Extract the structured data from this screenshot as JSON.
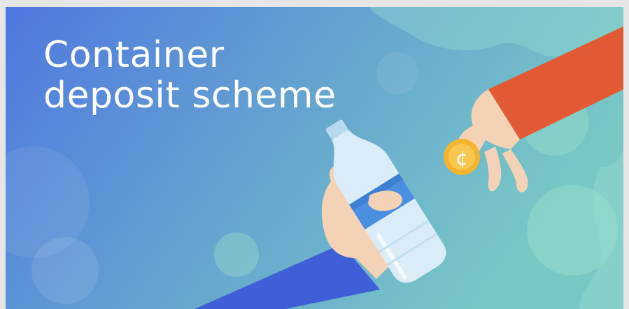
{
  "banner": {
    "title_line_1": "Container",
    "title_line_2": "deposit scheme",
    "coin_symbol": "¢"
  },
  "colors": {
    "gradient_left": "#4f78e0",
    "gradient_right": "#74c3c5",
    "bubble": "#8ed9c4",
    "sleeve_red": "#e25a33",
    "sleeve_blue": "#3f5fd8",
    "skin": "#f4d2b5",
    "coin": "#f3b52f",
    "bottle": "#d9ecf7",
    "bottle_label": "#4a8fe0"
  },
  "icons": [
    "coin-icon",
    "bottle-icon",
    "hand-icon"
  ]
}
